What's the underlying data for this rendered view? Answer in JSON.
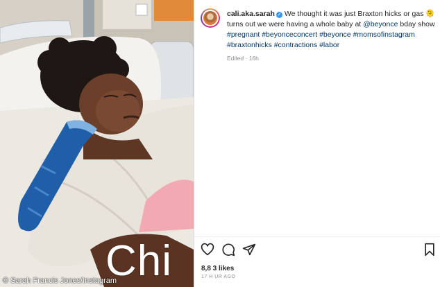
{
  "post": {
    "username": "cali.aka.sarah",
    "caption_text": "We thought it was just Braxton hicks or gas 🫠 turns out we were having a whole baby at ",
    "mention": "@beyonce",
    "caption_after_mention": " bday show",
    "hashtags": "#pregnant #beyonceconcert #beyonce #momsofinstagram #braxtonhicks #contractions #labor",
    "edited": "Edited · 16h",
    "likes": "8,8 3 likes",
    "timestamp": "17 H  UR  AGO"
  },
  "photo": {
    "video_caption": "Chi",
    "credit": "© Sarah Francis Jones/Instagram"
  },
  "icons": {
    "verified": "verified-badge-icon",
    "like": "heart-icon",
    "comment": "comment-icon",
    "share": "share-icon",
    "save": "bookmark-icon"
  },
  "colors": {
    "link": "#00376b",
    "verified": "#3897f0",
    "text": "#262626",
    "muted": "#8e8e8e"
  }
}
